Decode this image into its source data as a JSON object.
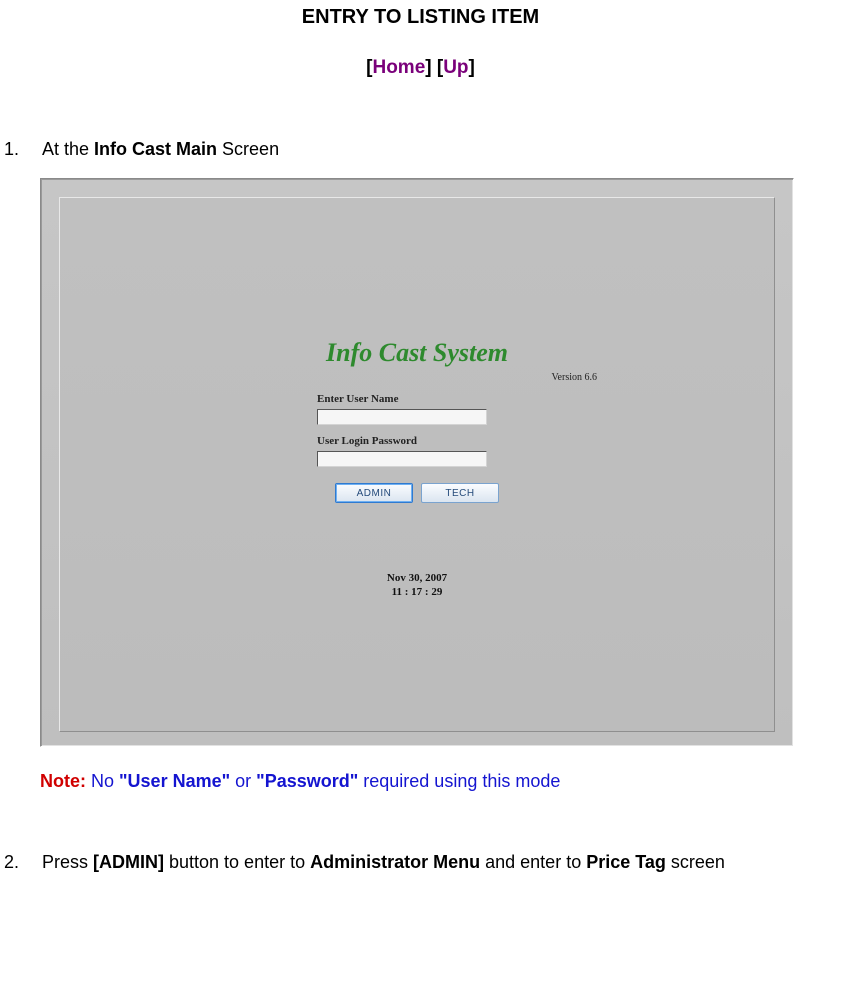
{
  "title": "ENTRY TO LISTING ITEM",
  "nav": {
    "home": "Home",
    "up": "Up"
  },
  "steps": {
    "s1": {
      "num": "1.",
      "pre": "At the ",
      "bold": "Info Cast Main",
      "post": " Screen"
    },
    "s2": {
      "num": "2.",
      "t1": "Press ",
      "b1": "[ADMIN]",
      "t2": " button to enter to ",
      "b2": "Administrator Menu",
      "t3": " and enter to ",
      "b3": "Price Tag",
      "t4": " screen"
    }
  },
  "screenshot": {
    "title": "Info Cast System",
    "version": "Version 6.6",
    "username_label": "Enter User Name",
    "username_value": "",
    "password_label": "User Login Password",
    "password_value": "",
    "admin_btn": "ADMIN",
    "tech_btn": "TECH",
    "date": "Nov 30, 2007",
    "time": "11 : 17 : 29"
  },
  "note": {
    "prefix": "Note:",
    "t1": " No ",
    "b1": "\"User Name\"",
    "t2": " or ",
    "b2": "\"Password\"",
    "t3": " required using this mode"
  }
}
